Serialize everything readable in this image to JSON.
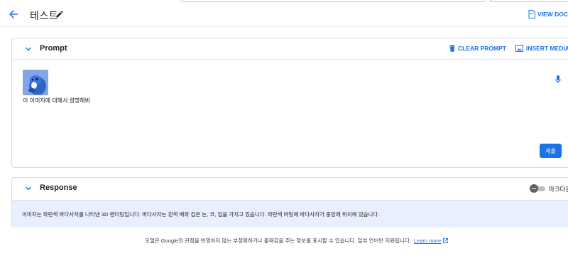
{
  "header": {
    "title": "테스트",
    "docs_label": "VIEW DOCS"
  },
  "prompt": {
    "title": "Prompt",
    "clear_label": "CLEAR PROMPT",
    "insert_label": "INSERT MEDIA",
    "text": "이 이미지에 대해서 설명해봐",
    "submit_label": "제출"
  },
  "response": {
    "title": "Response",
    "markdown_label": "마크다운",
    "text": "이미지는 파란색 바다사자를 나타낸 3D 렌더링입니다. 바다사자는 흰색 배와 검은 눈, 코, 입을 가지고 있습니다. 파란색 바탕에 바다사자가 중앙에 위치해 있습니다."
  },
  "footer": {
    "disclaimer": "모델은 Google의 관점을 반영하지 않는 부정확하거나 불쾌감을 주는 정보를 표시할 수 있습니다. 일부 언어만 지원됩니다.",
    "link_label": "Learn more"
  },
  "colors": {
    "accent": "#1a73e8",
    "response_bg": "#e8f0fe"
  },
  "icons": [
    "back-arrow-icon",
    "pencil-icon",
    "document-icon",
    "chevron-down-icon",
    "trash-icon",
    "image-icon",
    "microphone-icon",
    "open-external-icon"
  ]
}
